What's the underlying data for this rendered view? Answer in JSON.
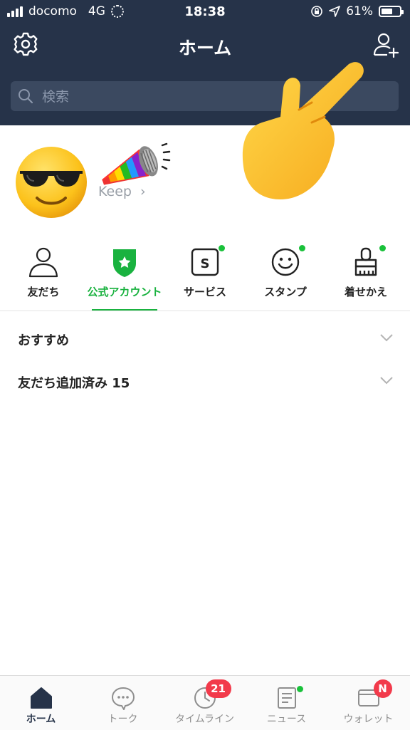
{
  "status_bar": {
    "carrier": "docomo",
    "network": "4G",
    "time": "18:38",
    "battery": "61%",
    "battery_level": 0.61
  },
  "header": {
    "title": "ホーム",
    "search_placeholder": "検索"
  },
  "profile": {
    "keep_label": "Keep",
    "keep_chevron": "›"
  },
  "categories": [
    {
      "label": "友だち",
      "icon": "person-icon",
      "dot": false,
      "active": false
    },
    {
      "label": "公式アカウント",
      "icon": "official-shield-icon",
      "dot": false,
      "active": true
    },
    {
      "label": "サービス",
      "icon": "service-s-icon",
      "dot": true,
      "active": false
    },
    {
      "label": "スタンプ",
      "icon": "smiley-icon",
      "dot": true,
      "active": false
    },
    {
      "label": "着せかえ",
      "icon": "brush-icon",
      "dot": true,
      "active": false
    }
  ],
  "service_icon_letter": "S",
  "sections": [
    {
      "label": "おすすめ"
    },
    {
      "label": "友だち追加済み 15"
    }
  ],
  "tabbar": [
    {
      "label": "ホーム",
      "icon": "home-icon",
      "active": true
    },
    {
      "label": "トーク",
      "icon": "chat-bubble-icon",
      "active": false
    },
    {
      "label": "タイムライン",
      "icon": "clock-icon",
      "active": false,
      "badge": "21"
    },
    {
      "label": "ニュース",
      "icon": "news-icon",
      "active": false
    },
    {
      "label": "ウォレット",
      "icon": "wallet-icon",
      "active": false,
      "badge": "N"
    }
  ],
  "colors": {
    "header_bg": "#263349",
    "accent_green": "#19b23f",
    "badge_red": "#f23a4b"
  }
}
